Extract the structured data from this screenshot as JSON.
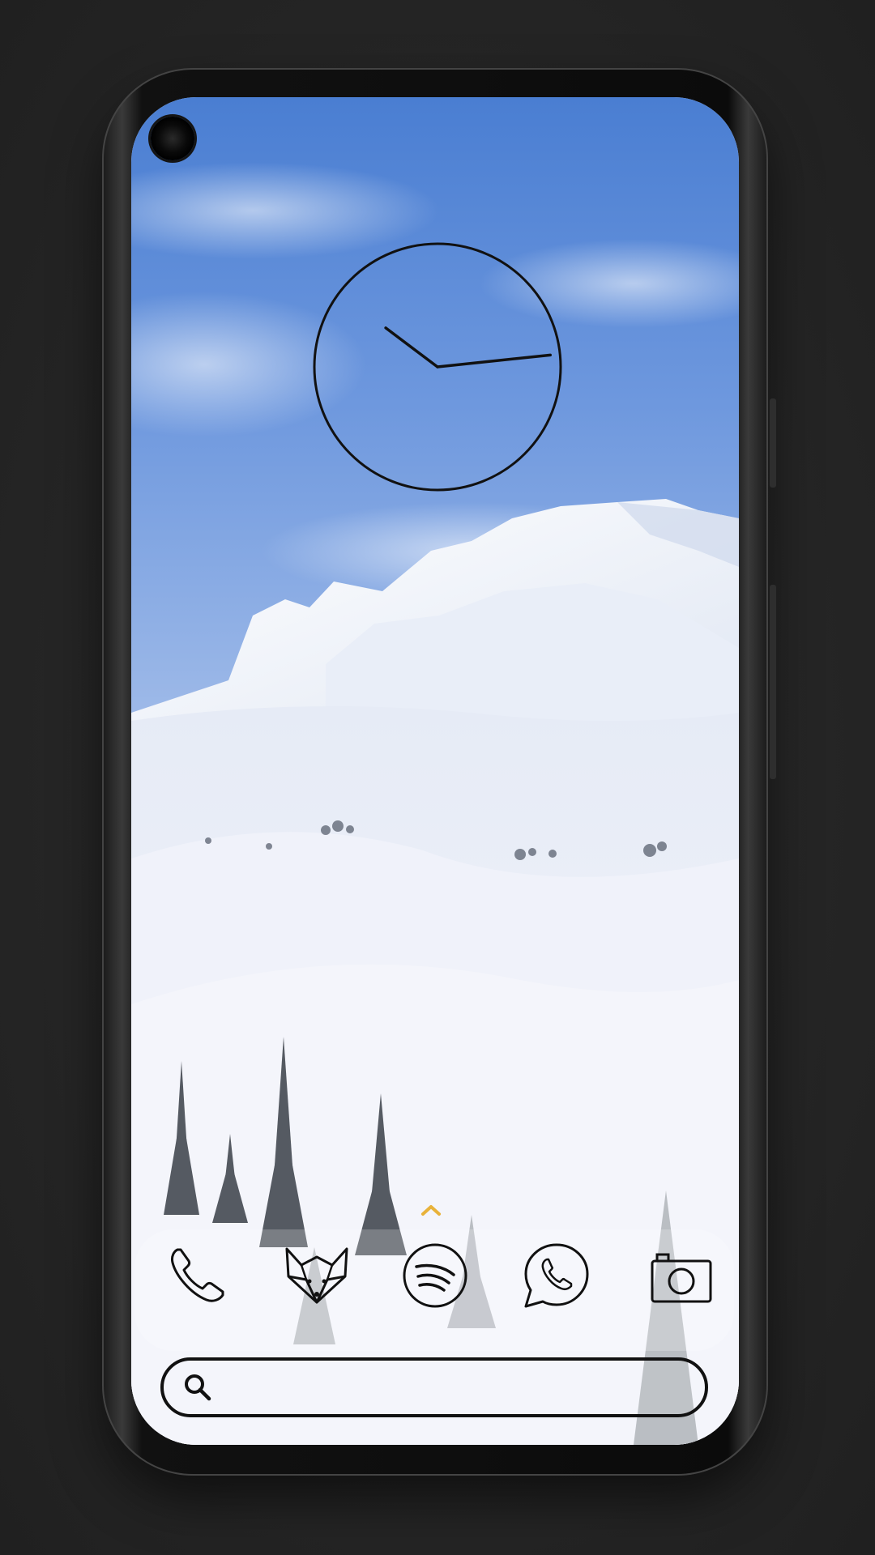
{
  "home": {
    "clock": {
      "hour": 10,
      "minute": 14
    },
    "dock": {
      "apps": [
        {
          "icon": "phone-icon"
        },
        {
          "icon": "firefox-fox-icon"
        },
        {
          "icon": "spotify-icon"
        },
        {
          "icon": "whatsapp-icon"
        },
        {
          "icon": "camera-icon"
        }
      ]
    },
    "search": {
      "placeholder": ""
    }
  },
  "colors": {
    "sky_top": "#4a7ed2",
    "sky_bottom": "#8fb1e6",
    "snow": "#f2f4fb",
    "icon_stroke": "#111111",
    "chevron": "#e8b23a",
    "phone_frame": "#0b0b0b",
    "background": "#262626"
  }
}
